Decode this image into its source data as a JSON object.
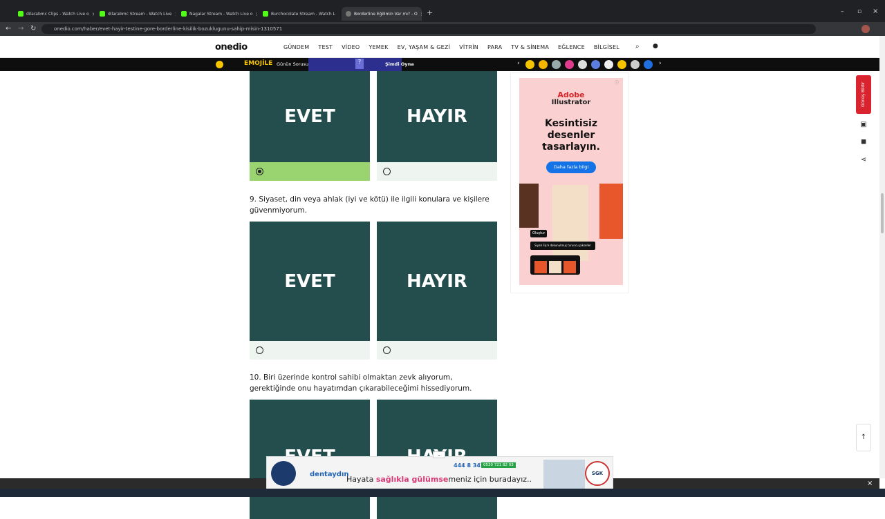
{
  "browser": {
    "tabs": [
      {
        "label": "dilarabmc Clips - Watch Live o"
      },
      {
        "label": "dilarabmc Stream - Watch Live"
      },
      {
        "label": "Nagalar Stream - Watch Live o"
      },
      {
        "label": "Burchocolate Stream - Watch L"
      },
      {
        "label": "Borderline Eğilimin Var mı? - O"
      }
    ],
    "url": "onedio.com/haber/evet-hayir-testine-gore-borderline-kisilik-bozuklugunu-sahip-misin-1310571"
  },
  "site": {
    "logo": "onedio",
    "nav": [
      "GÜNDEM",
      "TEST",
      "VİDEO",
      "YEMEK",
      "EV, YAŞAM & GEZİ",
      "VİTRİN",
      "PARA",
      "TV & SİNEMA",
      "EĞLENCE",
      "BİLGİSEL"
    ]
  },
  "gamebar": {
    "brand": "EMOJİLE",
    "daily": "Günün Sorusu",
    "play": "Şimdi Oyna",
    "question_mark": "?"
  },
  "quiz": {
    "prev": {
      "yes": "EVET",
      "no": "HAYIR",
      "selected": "yes"
    },
    "q9": {
      "text": "9. Siyaset, din veya ahlak (iyi ve kötü) ile ilgili konulara ve kişilere güvenmiyorum.",
      "yes": "EVET",
      "no": "HAYIR"
    },
    "q10": {
      "text": "10. Biri üzerinde kontrol sahibi olmaktan zevk alıyorum, gerektiğinde onu hayatımdan çıkarabileceğimi hissediyorum.",
      "yes": "EVET",
      "no": "HAYIR"
    }
  },
  "ad": {
    "brand_line1": "Adobe",
    "brand_line2": "Illustrator",
    "headline": "Kesintisiz desenler tasarlayın.",
    "cta": "Daha fazla bilgi",
    "chip1": "Oluştur",
    "chip2": "Siyah Fiş'e dokunulmuş turuncu pikseller"
  },
  "side": {
    "report": "Gönüş Bildir"
  },
  "bottom_ad": {
    "brand": "dentaydın",
    "text_prefix": "Hayata ",
    "text_highlight": "sağlıkla gülümse",
    "text_suffix": "meniz için buradayız..",
    "phone": "444 8 347",
    "whatsapp": "0530 721 82 03",
    "sgk": "SGK"
  },
  "colors": {
    "card_bg": "#234e4d",
    "selected": "#9ad471",
    "radio_bg": "#eef4f0",
    "report_red": "#d9232e"
  }
}
